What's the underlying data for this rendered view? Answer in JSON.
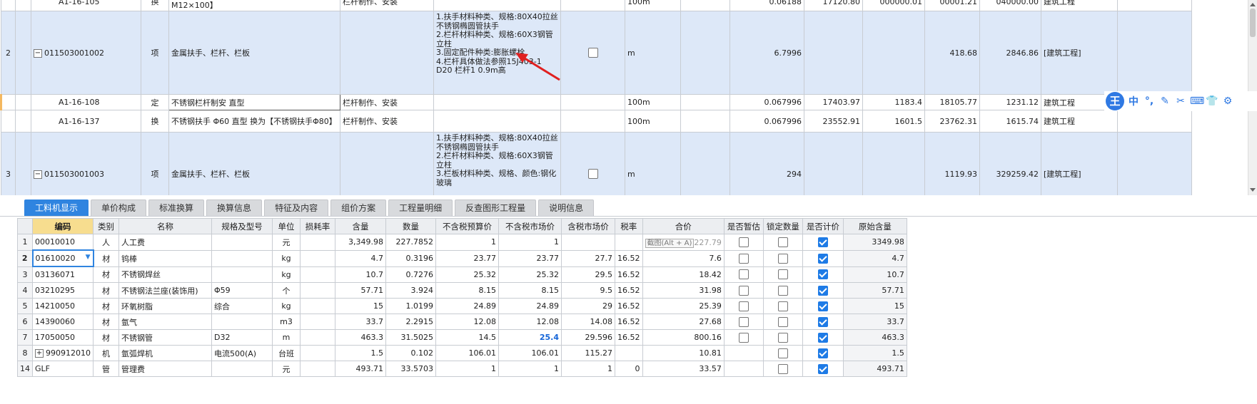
{
  "top_grid": {
    "rows": [
      {
        "type": "partial",
        "code": "A1-16-105",
        "kind": "换",
        "name": "M12×100】",
        "feature": "栏杆制作、安装",
        "unit": "100m",
        "qty": "0.06188",
        "p1": "17120.80",
        "p2": "000000.01",
        "p3": "00001.21",
        "p4": "040000.00",
        "attr": "建筑工程"
      },
      {
        "type": "item",
        "rownum": "2",
        "code": "011503001002",
        "kind": "项",
        "name": "金属扶手、栏杆、栏板",
        "desc": "1.扶手材料种类、规格:80X40拉丝不锈钢椭圆管扶手\n2.栏杆材料种类、规格:60X3钢管立柱\n3.固定配件种类:膨胀螺栓\n4.栏杆具体做法参照15J403-1 D20 栏杆1 0.9m高",
        "unit": "m",
        "qty": "6.7996",
        "p1": "",
        "p2": "",
        "p3": "418.68",
        "p4": "2846.86",
        "attr": "[建筑工程]"
      },
      {
        "type": "sub",
        "code": "A1-16-108",
        "kind": "定",
        "name": "不锈钢栏杆制安 直型",
        "feature": "栏杆制作、安装",
        "unit": "100m",
        "qty": "0.067996",
        "p1": "17403.97",
        "p2": "1183.4",
        "p3": "18105.77",
        "p4": "1231.12",
        "attr": "建筑工程"
      },
      {
        "type": "sub",
        "code": "A1-16-137",
        "kind": "换",
        "name": "不锈钢扶手 Φ60 直型 换为【不锈钢扶手Φ80】",
        "feature": "栏杆制作、安装",
        "unit": "100m",
        "qty": "0.067996",
        "p1": "23552.91",
        "p2": "1601.5",
        "p3": "23762.31",
        "p4": "1615.74",
        "attr": "建筑工程"
      },
      {
        "type": "item",
        "rownum": "3",
        "code": "011503001003",
        "kind": "项",
        "name": "金属扶手、栏杆、栏板",
        "desc": "1.扶手材料种类、规格:80X40拉丝不锈钢椭圆管扶手\n2.栏杆材料种类、规格:60X3钢管立柱\n3.栏板材料种类、规格、颜色:钢化玻璃",
        "unit": "m",
        "qty": "294",
        "p1": "",
        "p2": "",
        "p3": "1119.93",
        "p4": "329259.42",
        "attr": "[建筑工程]"
      }
    ]
  },
  "ime_toolbar": {
    "logo": "王",
    "mode": "中",
    "punct": "°,"
  },
  "tabs": [
    "工料机显示",
    "单价构成",
    "标准换算",
    "换算信息",
    "特征及内容",
    "组价方案",
    "工程量明细",
    "反查图形工程量",
    "说明信息"
  ],
  "bottom_grid": {
    "headers": [
      "编码",
      "类别",
      "名称",
      "规格及型号",
      "单位",
      "损耗率",
      "含量",
      "数量",
      "不含税预算价",
      "不含税市场价",
      "含税市场价",
      "税率",
      "合价",
      "是否暂估",
      "锁定数量",
      "是否计价",
      "原始含量"
    ],
    "tooltip": "截图(Alt + A)",
    "rows": [
      {
        "rn": "1",
        "code": "00010010",
        "kind": "人",
        "name": "人工费",
        "spec": "",
        "unit": "元",
        "loss": "",
        "content": "3,349.98",
        "qty": "227.7852",
        "p_budget": "1",
        "p_market": "1",
        "p_tax_market": "",
        "tax": "",
        "total": "227.79",
        "est": false,
        "lock": false,
        "priced": true,
        "orig": "3349.98"
      },
      {
        "rn": "2",
        "code": "01610020",
        "kind": "材",
        "name": "钨棒",
        "spec": "",
        "unit": "kg",
        "loss": "",
        "content": "4.7",
        "qty": "0.3196",
        "p_budget": "23.77",
        "p_market": "23.77",
        "p_tax_market": "27.7",
        "tax": "16.52",
        "total": "7.6",
        "est": false,
        "lock": false,
        "priced": true,
        "orig": "4.7"
      },
      {
        "rn": "3",
        "code": "03136071",
        "kind": "材",
        "name": "不锈钢焊丝",
        "spec": "",
        "unit": "kg",
        "loss": "",
        "content": "10.7",
        "qty": "0.7276",
        "p_budget": "25.32",
        "p_market": "25.32",
        "p_tax_market": "29.5",
        "tax": "16.52",
        "total": "18.42",
        "est": false,
        "lock": false,
        "priced": true,
        "orig": "10.7"
      },
      {
        "rn": "4",
        "code": "03210295",
        "kind": "材",
        "name": "不锈钢法兰座(装饰用)",
        "spec": "Φ59",
        "unit": "个",
        "loss": "",
        "content": "57.71",
        "qty": "3.924",
        "p_budget": "8.15",
        "p_market": "8.15",
        "p_tax_market": "9.5",
        "tax": "16.52",
        "total": "31.98",
        "est": false,
        "lock": false,
        "priced": true,
        "orig": "57.71"
      },
      {
        "rn": "5",
        "code": "14210050",
        "kind": "材",
        "name": "环氧树脂",
        "spec": "综合",
        "unit": "kg",
        "loss": "",
        "content": "15",
        "qty": "1.0199",
        "p_budget": "24.89",
        "p_market": "24.89",
        "p_tax_market": "29",
        "tax": "16.52",
        "total": "25.39",
        "est": false,
        "lock": false,
        "priced": true,
        "orig": "15"
      },
      {
        "rn": "6",
        "code": "14390060",
        "kind": "材",
        "name": "氩气",
        "spec": "",
        "unit": "m3",
        "loss": "",
        "content": "33.7",
        "qty": "2.2915",
        "p_budget": "12.08",
        "p_market": "12.08",
        "p_tax_market": "14.08",
        "tax": "16.52",
        "total": "27.68",
        "est": false,
        "lock": false,
        "priced": true,
        "orig": "33.7"
      },
      {
        "rn": "7",
        "code": "17050050",
        "kind": "材",
        "name": "不锈钢管",
        "spec": "D32",
        "unit": "m",
        "loss": "",
        "content": "463.3",
        "qty": "31.5025",
        "p_budget": "14.5",
        "p_market": "25.4",
        "p_tax_market": "29.596",
        "tax": "16.52",
        "total": "800.16",
        "est": false,
        "lock": false,
        "priced": true,
        "orig": "463.3"
      },
      {
        "rn": "8",
        "code": "990912010",
        "kind": "机",
        "name": "氩弧焊机",
        "spec": "电流500(A)",
        "unit": "台班",
        "loss": "",
        "content": "1.5",
        "qty": "0.102",
        "p_budget": "106.01",
        "p_market": "106.01",
        "p_tax_market": "115.27",
        "tax": "",
        "total": "10.81",
        "est": null,
        "lock": false,
        "priced": true,
        "orig": "1.5"
      },
      {
        "rn": "14",
        "code": "GLF",
        "kind": "管",
        "name": "管理费",
        "spec": "",
        "unit": "元",
        "loss": "",
        "content": "493.71",
        "qty": "33.5703",
        "p_budget": "1",
        "p_market": "1",
        "p_tax_market": "1",
        "tax": "0",
        "total": "33.57",
        "est": null,
        "lock": false,
        "priced": true,
        "orig": "493.71"
      }
    ]
  }
}
